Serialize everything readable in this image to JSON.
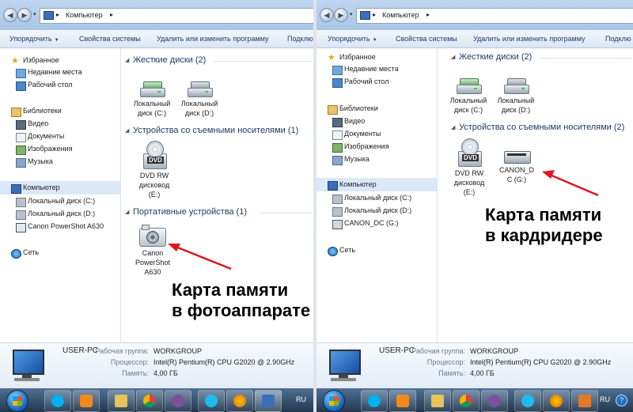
{
  "address": {
    "crumb": "Компьютер"
  },
  "toolbar": {
    "organize": "Упорядочить",
    "system_props": "Свойства системы",
    "uninstall": "Удалить или изменить программу",
    "connect": "Подклю"
  },
  "left": {
    "nav": {
      "favorites": "Избранное",
      "recent": "Недавние места",
      "desktop": "Рабочий стол",
      "libraries": "Библиотеки",
      "video": "Видео",
      "documents": "Документы",
      "images": "Изображения",
      "music": "Музыка",
      "computer": "Компьютер",
      "disk_c": "Локальный диск (C:)",
      "disk_d": "Локальный диск (D:)",
      "canon": "Canon PowerShot A630",
      "network": "Сеть"
    },
    "groups": {
      "hdd": "Жесткие диски (2)",
      "removable": "Устройства со съемными носителями (1)",
      "portable": "Портативные устройства (1)"
    },
    "tiles": {
      "c_line1": "Локальный",
      "c_line2": "диск (C:)",
      "d_line1": "Локальный",
      "d_line2": "диск (D:)",
      "dvd_line1": "DVD RW",
      "dvd_line2": "дисковод",
      "dvd_line3": "(E:)",
      "cam_line1": "Canon",
      "cam_line2": "PowerShot",
      "cam_line3": "A630"
    },
    "annotation": {
      "line1": "Карта памяти",
      "line2": "в фотоаппарате"
    }
  },
  "right": {
    "nav": {
      "favorites": "Избранное",
      "recent": "Недавние места",
      "desktop": "Рабочий стол",
      "libraries": "Библиотеки",
      "video": "Видео",
      "documents": "Документы",
      "images": "Изображения",
      "music": "Музыка",
      "computer": "Компьютер",
      "disk_c": "Локальный диск (C:)",
      "disk_d": "Локальный диск (D:)",
      "canon_dc": "CANON_DC (G:)",
      "network": "Сеть"
    },
    "groups": {
      "hdd": "Жесткие диски (2)",
      "removable": "Устройства со съемными носителями (2)"
    },
    "tiles": {
      "c_line1": "Локальный",
      "c_line2": "диск (C:)",
      "d_line1": "Локальный",
      "d_line2": "диск (D:)",
      "dvd_line1": "DVD RW",
      "dvd_line2": "дисковод",
      "dvd_line3": "(E:)",
      "card_line1": "CANON_D",
      "card_line2": "C (G:)"
    },
    "annotation": {
      "line1": "Карта памяти",
      "line2": "в кардридере"
    }
  },
  "details": {
    "pc_name": "USER-PC",
    "workgroup_label": "Рабочая группа:",
    "workgroup_value": "WORKGROUP",
    "cpu_label": "Процессор:",
    "cpu_value": "Intel(R) Pentium(R) CPU G2020 @ 2.90GHz",
    "ram_label": "Память:",
    "ram_value": "4,00 ГБ"
  },
  "taskbar": {
    "lang": "RU"
  },
  "colors": {
    "arrow": "#e0141e",
    "accent": "#1e3b66"
  }
}
